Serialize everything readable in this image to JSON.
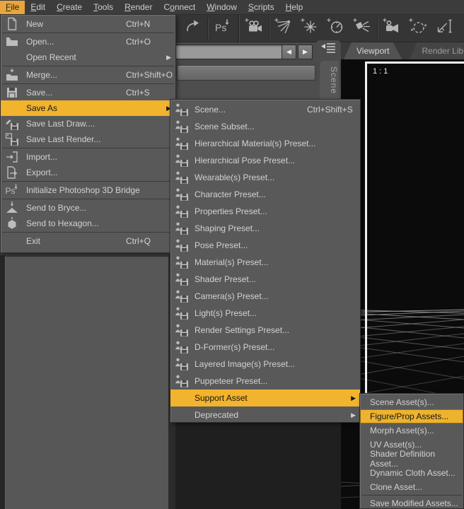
{
  "menubar": {
    "items": [
      {
        "label": "File",
        "mnemonic": 0,
        "highlighted": true
      },
      {
        "label": "Edit",
        "mnemonic": 0
      },
      {
        "label": "Create",
        "mnemonic": 0
      },
      {
        "label": "Tools",
        "mnemonic": 0
      },
      {
        "label": "Render",
        "mnemonic": 0
      },
      {
        "label": "Connect",
        "mnemonic": 1
      },
      {
        "label": "Window",
        "mnemonic": 0
      },
      {
        "label": "Scripts",
        "mnemonic": 0
      },
      {
        "label": "Help",
        "mnemonic": 0
      }
    ]
  },
  "toolbar": {
    "entries": [
      {
        "type": "button",
        "name": "redo-button",
        "icon": "redo-icon"
      },
      {
        "type": "separator"
      },
      {
        "type": "button",
        "name": "photoshop-3d-bridge-button",
        "icon": "photoshop-ps-icon",
        "ps_label": "Ps"
      },
      {
        "type": "group-separator"
      },
      {
        "type": "button",
        "name": "new-camera-button",
        "icon": "new-camera-icon"
      },
      {
        "type": "separator"
      },
      {
        "type": "button",
        "name": "new-distant-light-button",
        "icon": "new-distant-light-icon"
      },
      {
        "type": "button",
        "name": "new-point-light-button",
        "icon": "new-point-light-icon"
      },
      {
        "type": "button",
        "name": "new-linear-point-light-button",
        "icon": "new-linear-point-light-icon"
      },
      {
        "type": "button",
        "name": "new-spotlight-button",
        "icon": "new-spotlight-icon"
      },
      {
        "type": "separator"
      },
      {
        "type": "button",
        "name": "new-view-camera-button",
        "icon": "new-view-camera-icon"
      },
      {
        "type": "button",
        "name": "orbit-tool-button",
        "icon": "orbit-icon"
      },
      {
        "type": "button",
        "name": "measure-tool-button",
        "icon": "measure-tool-icon"
      }
    ]
  },
  "file_menu": {
    "items": [
      {
        "label": "New",
        "icon": "new-file-icon",
        "shortcut": "Ctrl+N"
      },
      {
        "type": "separator"
      },
      {
        "label": "Open...",
        "icon": "open-file-icon",
        "shortcut": "Ctrl+O"
      },
      {
        "label": "Open Recent",
        "submenu": true
      },
      {
        "type": "separator"
      },
      {
        "label": "Merge...",
        "icon": "merge-icon",
        "shortcut": "Ctrl+Shift+O"
      },
      {
        "type": "separator"
      },
      {
        "label": "Save...",
        "icon": "save-icon",
        "shortcut": "Ctrl+S"
      },
      {
        "label": "Save As",
        "submenu": true,
        "highlighted": true
      },
      {
        "label": "Save Last Draw....",
        "icon": "save-last-draw-icon"
      },
      {
        "label": "Save Last Render...",
        "icon": "save-last-render-icon"
      },
      {
        "type": "separator"
      },
      {
        "label": "Import...",
        "icon": "import-icon"
      },
      {
        "label": "Export...",
        "icon": "export-icon"
      },
      {
        "type": "separator"
      },
      {
        "label": "Initialize Photoshop 3D Bridge",
        "icon": "photoshop-bridge-icon"
      },
      {
        "type": "separator"
      },
      {
        "label": "Send to Bryce...",
        "icon": "send-to-bryce-icon"
      },
      {
        "label": "Send to Hexagon...",
        "icon": "send-to-hexagon-icon"
      },
      {
        "type": "separator"
      },
      {
        "label": "Exit",
        "shortcut": "Ctrl+Q"
      }
    ]
  },
  "save_as_menu": {
    "items": [
      {
        "label": "Scene...",
        "icon": "scene-preset-icon",
        "shortcut": "Ctrl+Shift+S"
      },
      {
        "label": "Scene Subset...",
        "icon": "scene-subset-preset-icon"
      },
      {
        "label": "Hierarchical Material(s) Preset...",
        "icon": "hierarchical-material-preset-icon"
      },
      {
        "label": "Hierarchical Pose Preset...",
        "icon": "hierarchical-pose-preset-icon"
      },
      {
        "label": "Wearable(s) Preset...",
        "icon": "wearable-preset-icon"
      },
      {
        "label": "Character Preset...",
        "icon": "character-preset-icon"
      },
      {
        "label": "Properties Preset...",
        "icon": "properties-preset-icon"
      },
      {
        "label": "Shaping Preset...",
        "icon": "shaping-preset-icon"
      },
      {
        "label": "Pose Preset...",
        "icon": "pose-preset-icon"
      },
      {
        "label": "Material(s) Preset...",
        "icon": "material-preset-icon"
      },
      {
        "label": "Shader Preset...",
        "icon": "shader-preset-icon"
      },
      {
        "label": "Camera(s) Preset...",
        "icon": "camera-preset-icon"
      },
      {
        "label": "Light(s) Preset...",
        "icon": "light-preset-icon"
      },
      {
        "label": "Render Settings Preset...",
        "icon": "render-settings-preset-icon"
      },
      {
        "label": "D-Former(s) Preset...",
        "icon": "d-former-preset-icon"
      },
      {
        "label": "Layered Image(s) Preset...",
        "icon": "layered-image-preset-icon"
      },
      {
        "label": "Puppeteer Preset...",
        "icon": "puppeteer-preset-icon"
      },
      {
        "label": "Support Asset",
        "submenu": true,
        "highlighted": true
      },
      {
        "label": "Deprecated",
        "submenu": true
      }
    ]
  },
  "support_asset_menu": {
    "items": [
      {
        "label": "Scene Asset(s)..."
      },
      {
        "label": "Figure/Prop Assets...",
        "highlighted": true
      },
      {
        "label": "Morph Asset(s)..."
      },
      {
        "label": "UV Asset(s)..."
      },
      {
        "label": "Shader Definition Asset..."
      },
      {
        "label": "Dynamic Cloth Asset..."
      },
      {
        "label": "Clone Asset..."
      },
      {
        "type": "separator"
      },
      {
        "label": "Save Modified Assets..."
      }
    ]
  },
  "pane": {
    "nav_input_value": "",
    "back_icon": "◀",
    "forward_icon": "▶",
    "scene_tab_label": "Scene"
  },
  "viewport": {
    "tab_viewport": "Viewport",
    "tab_render_library": "Render Libra",
    "aspect_label": "1 : 1"
  },
  "colors": {
    "accent_gold": "#edb32f",
    "menubar_highlight": "#e8a63c",
    "menu_bg": "#595959",
    "menu_text": "#d2d2d2",
    "toolbar_bg": "#353535",
    "panel_gray": "#575757",
    "viewport_bg": "#0b0b0b",
    "frame_white": "#f2f2f2"
  }
}
